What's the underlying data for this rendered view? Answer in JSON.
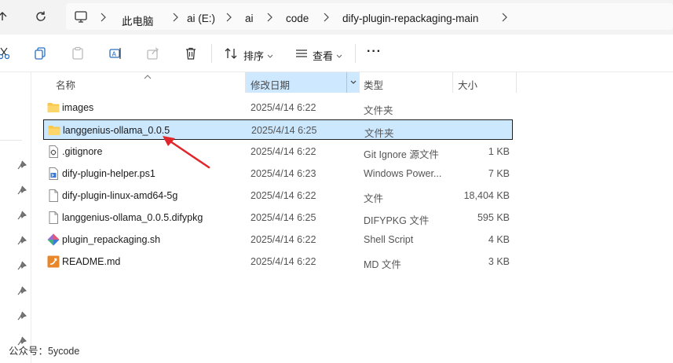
{
  "address_bar": {
    "crumbs": [
      "此电脑",
      "ai (E:)",
      "ai",
      "code",
      "dify-plugin-repackaging-main"
    ]
  },
  "toolbar": {
    "sort_label": "排序",
    "view_label": "查看",
    "more_label": "···"
  },
  "columns": {
    "name": "名称",
    "date": "修改日期",
    "type": "类型",
    "size": "大小"
  },
  "files": [
    {
      "name": "images",
      "date": "2025/4/14 6:22",
      "type": "文件夹",
      "size": "",
      "icon": "folder-icon"
    },
    {
      "name": "langgenius-ollama_0.0.5",
      "date": "2025/4/14 6:25",
      "type": "文件夹",
      "size": "",
      "icon": "folder-icon",
      "selected": true
    },
    {
      "name": ".gitignore",
      "date": "2025/4/14 6:22",
      "type": "Git Ignore 源文件",
      "size": "1 KB",
      "icon": "gitignore-file-icon"
    },
    {
      "name": "dify-plugin-helper.ps1",
      "date": "2025/4/14 6:23",
      "type": "Windows Power...",
      "size": "7 KB",
      "icon": "powershell-file-icon"
    },
    {
      "name": "dify-plugin-linux-amd64-5g",
      "date": "2025/4/14 6:22",
      "type": "文件",
      "size": "18,404 KB",
      "icon": "blank-file-icon"
    },
    {
      "name": "langgenius-ollama_0.0.5.difypkg",
      "date": "2025/4/14 6:25",
      "type": "DIFYPKG 文件",
      "size": "595 KB",
      "icon": "blank-file-icon"
    },
    {
      "name": "plugin_repackaging.sh",
      "date": "2025/4/14 6:22",
      "type": "Shell Script",
      "size": "4 KB",
      "icon": "shell-script-icon"
    },
    {
      "name": "README.md",
      "date": "2025/4/14 6:22",
      "type": "MD 文件",
      "size": "3 KB",
      "icon": "markdown-file-icon"
    }
  ],
  "footer": {
    "text": "公众号：5ycode"
  },
  "colors": {
    "selection": "#cce8ff",
    "folder": "#f8c84a",
    "arrow": "#e0262a"
  }
}
